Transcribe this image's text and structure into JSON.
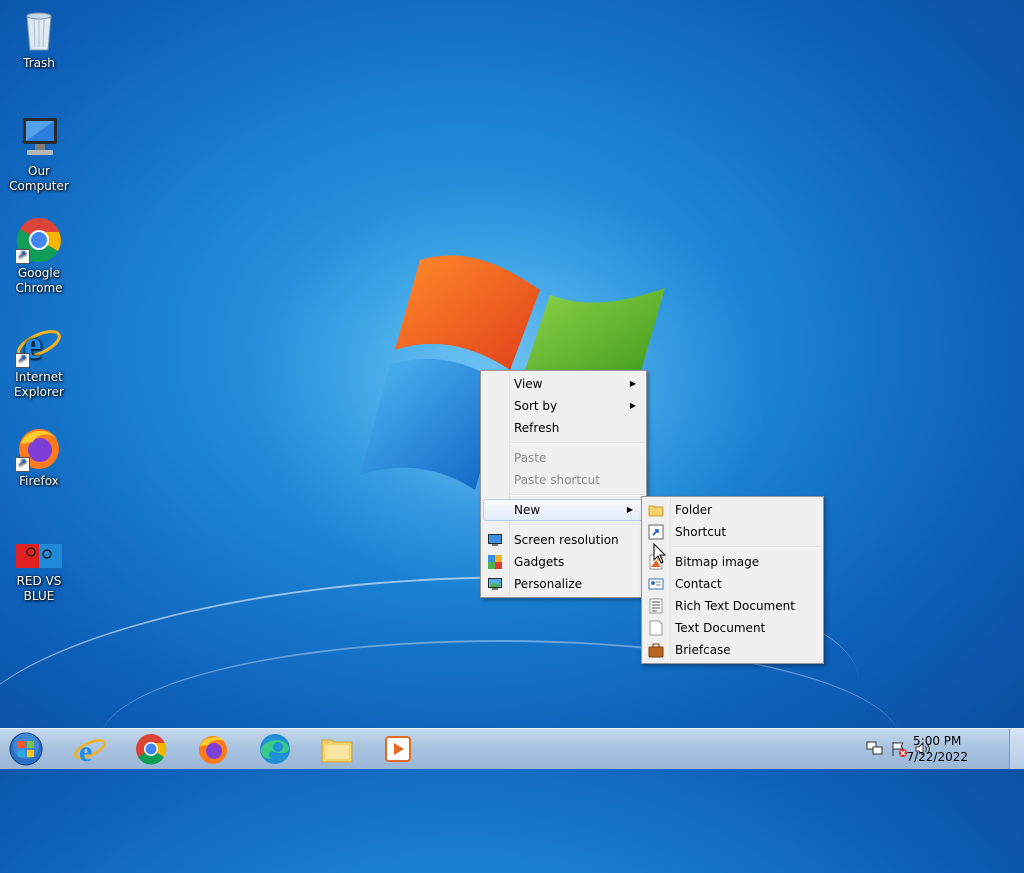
{
  "desktop": {
    "icons": [
      {
        "label": "Trash"
      },
      {
        "label": "Our Computer"
      },
      {
        "label": "Google Chrome"
      },
      {
        "label": "Internet Explorer"
      },
      {
        "label": "Firefox"
      },
      {
        "label": "RED VS BLUE"
      }
    ]
  },
  "context_menu": {
    "items": [
      {
        "label": "View"
      },
      {
        "label": "Sort by"
      },
      {
        "label": "Refresh"
      },
      {
        "label": "Paste"
      },
      {
        "label": "Paste shortcut"
      },
      {
        "label": "New"
      },
      {
        "label": "Screen resolution"
      },
      {
        "label": "Gadgets"
      },
      {
        "label": "Personalize"
      }
    ]
  },
  "new_submenu": {
    "items": [
      {
        "label": "Folder"
      },
      {
        "label": "Shortcut"
      },
      {
        "label": "Bitmap image"
      },
      {
        "label": "Contact"
      },
      {
        "label": "Rich Text Document"
      },
      {
        "label": "Text Document"
      },
      {
        "label": "Briefcase"
      }
    ]
  },
  "taskbar": {
    "pinned": [
      "internet-explorer",
      "google-chrome",
      "firefox",
      "edge",
      "file-explorer",
      "media-player"
    ],
    "clock": {
      "time": "5:00 PM",
      "date": "7/22/2022"
    }
  }
}
